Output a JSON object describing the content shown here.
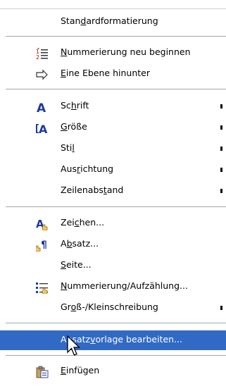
{
  "menu": {
    "top_partial_text": "",
    "items": [
      {
        "pre": "Stan",
        "u": "d",
        "post": "ardformatierung"
      },
      {
        "pre": "",
        "u": "N",
        "post": "ummerierung neu beginnen"
      },
      {
        "pre": "",
        "u": "E",
        "post": "ine Ebene hinunter"
      },
      {
        "pre": "Sc",
        "u": "h",
        "post": "rift"
      },
      {
        "pre": "",
        "u": "G",
        "post": "röße"
      },
      {
        "pre": "Sti",
        "u": "l",
        "post": ""
      },
      {
        "pre": "Aus",
        "u": "r",
        "post": "ichtung"
      },
      {
        "pre": "Zeilenabs",
        "u": "t",
        "post": "and"
      },
      {
        "pre": "Zei",
        "u": "c",
        "post": "hen..."
      },
      {
        "pre": "A",
        "u": "b",
        "post": "satz..."
      },
      {
        "pre": "",
        "u": "S",
        "post": "eite..."
      },
      {
        "pre": "",
        "u": "N",
        "post": "ummerierung/Aufzählung..."
      },
      {
        "pre": "Gr",
        "u": "o",
        "post": "ß-/Kleinschreibung"
      },
      {
        "pre": "Absatz",
        "u": "v",
        "post": "orlage bearbeiten..."
      },
      {
        "pre": "",
        "u": "E",
        "post": "infügen"
      }
    ]
  }
}
